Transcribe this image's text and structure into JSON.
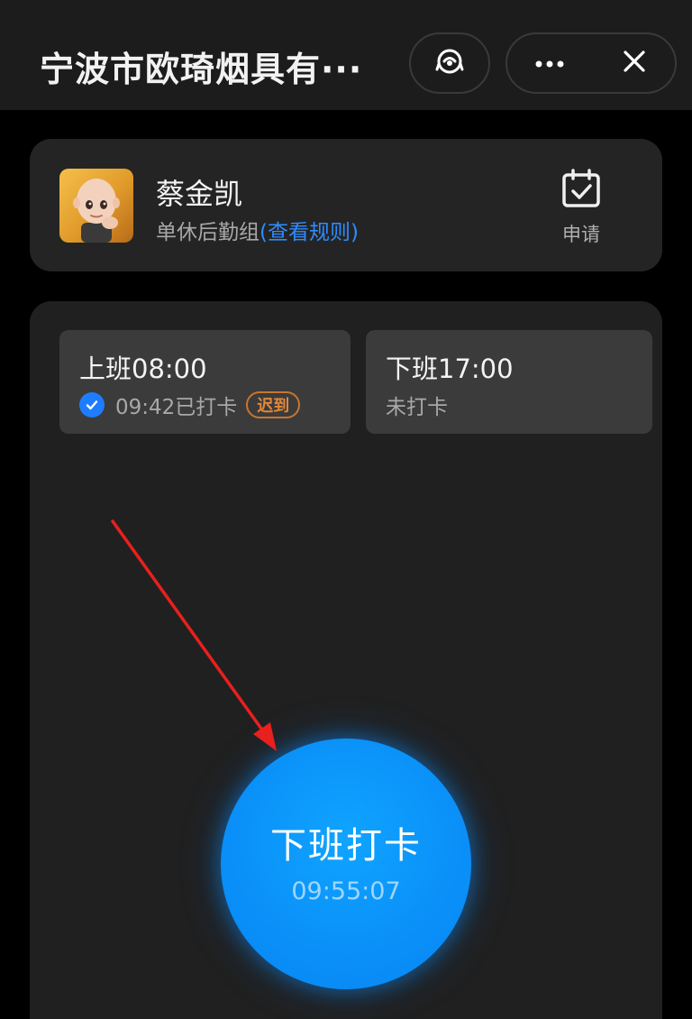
{
  "app_bar": {
    "title": "宁波市欧琦烟具有···",
    "voice_icon": "voice-assistant-icon",
    "more_icon": "more-dots-icon",
    "close_icon": "close-icon"
  },
  "profile": {
    "name": "蔡金凯",
    "group": "单休后勤组",
    "rules_link": "(查看规则)",
    "apply_icon": "calendar-check-icon",
    "apply_label": "申请"
  },
  "shifts": [
    {
      "title": "上班08:00",
      "status": "09:42已打卡",
      "status_icon": "check-circle-icon",
      "badge": "迟到"
    },
    {
      "title": "下班17:00",
      "status": "未打卡"
    }
  ],
  "punch_button": {
    "label": "下班打卡",
    "time": "09:55:07"
  },
  "colors": {
    "accent": "#0a8ff8",
    "link": "#2f8bff",
    "late": "#e2873a",
    "annotation_arrow": "#e8201e"
  }
}
